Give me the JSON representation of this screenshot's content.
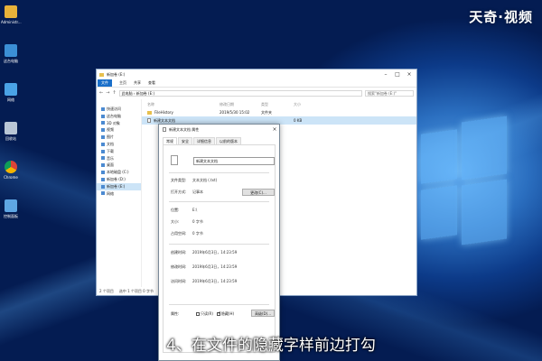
{
  "watermark": "天奇·视频",
  "caption": "4、在文件的隐藏字样前边打勾",
  "desktop_icons": [
    {
      "label": "Administr...",
      "icon": "user-folder-icon",
      "color": "#e8b23a"
    },
    {
      "label": "这台电脑",
      "icon": "computer-icon",
      "color": "#3b8fd6"
    },
    {
      "label": "网络",
      "icon": "network-icon",
      "color": "#4aa3e6"
    },
    {
      "label": "回收站",
      "icon": "recycle-bin-icon",
      "color": "#b9c6d6"
    },
    {
      "label": "Chrome",
      "icon": "chrome-icon",
      "color": "#e04b36"
    },
    {
      "label": "控制面板",
      "icon": "control-panel-icon",
      "color": "#5fa6e3"
    }
  ],
  "explorer": {
    "title": "新加卷 (E:)",
    "ribbon_tabs": [
      "文件",
      "主页",
      "共享",
      "查看"
    ],
    "address_path": "此电脑 › 新加卷 (E:)",
    "search_placeholder": "搜索\"新加卷 (E:)\"",
    "sidebar_items": [
      {
        "label": "快速访问",
        "selected": false
      },
      {
        "label": "这台电脑",
        "selected": false
      },
      {
        "label": "3D 对象",
        "selected": false
      },
      {
        "label": "视频",
        "selected": false
      },
      {
        "label": "图片",
        "selected": false
      },
      {
        "label": "文档",
        "selected": false
      },
      {
        "label": "下载",
        "selected": false
      },
      {
        "label": "音乐",
        "selected": false
      },
      {
        "label": "桌面",
        "selected": false
      },
      {
        "label": "本地磁盘 (C:)",
        "selected": false
      },
      {
        "label": "新加卷 (D:)",
        "selected": false
      },
      {
        "label": "新加卷 (E:)",
        "selected": true
      },
      {
        "label": "网络",
        "selected": false
      }
    ],
    "columns": [
      "名称",
      "修改日期",
      "类型",
      "大小"
    ],
    "files": [
      {
        "name": "FileHistory",
        "date": "2019/5/30 15:02",
        "type": "文件夹",
        "size": "",
        "icon": "folder-icon",
        "selected": false
      },
      {
        "name": "新建文本文档",
        "date": "",
        "type": "",
        "size": "0 KB",
        "icon": "text-file-icon",
        "selected": true
      }
    ],
    "status": [
      "2 个项目",
      "选中 1 个项目 0 字节"
    ]
  },
  "dialog": {
    "title": "新建文本文档 属性",
    "tabs": [
      "常规",
      "安全",
      "详细信息",
      "以前的版本"
    ],
    "filename": "新建文本文档",
    "rows1": [
      {
        "k": "文件类型:",
        "v": "文本文档 (.txt)"
      },
      {
        "k": "打开方式:",
        "v": "记事本"
      }
    ],
    "change_button": "更改(C)...",
    "rows2": [
      {
        "k": "位置:",
        "v": "E:\\"
      },
      {
        "k": "大小:",
        "v": "0 字节"
      },
      {
        "k": "占用空间:",
        "v": "0 字节"
      }
    ],
    "rows3": [
      {
        "k": "创建时间:",
        "v": "2019年6月3日，14:23:59"
      },
      {
        "k": "修改时间:",
        "v": "2019年6月3日，14:23:59"
      },
      {
        "k": "访问时间:",
        "v": "2019年6月3日，14:23:59"
      }
    ],
    "attributes_label": "属性:",
    "readonly_label": "只读(R)",
    "readonly_checked": false,
    "hidden_label": "隐藏(H)",
    "hidden_checked": true,
    "advanced_button": "高级(D)..."
  }
}
